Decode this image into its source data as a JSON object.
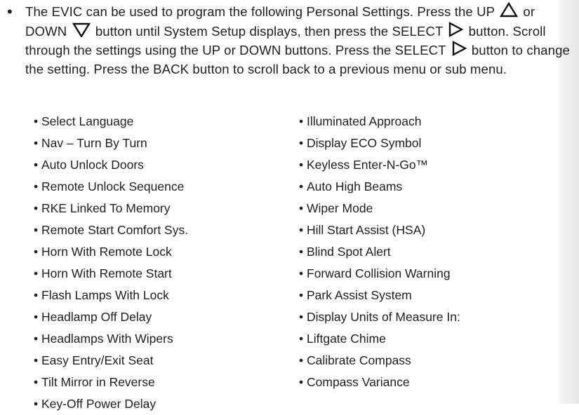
{
  "intro": {
    "bullet": "•",
    "seg1": "The EVIC can be used to program the following Personal Settings. Press the UP",
    "up_icon": "up-triangle-icon",
    "seg2": "or DOWN",
    "down_icon": "down-triangle-icon",
    "seg3": "button until System Setup displays, then press the SELECT",
    "select_icon": "right-triangle-icon",
    "seg4": "button. Scroll through the settings using the UP or DOWN buttons. Press the SELECT",
    "seg5": "button to change the setting. Press the BACK button to scroll back to a previous menu or sub menu."
  },
  "settings_left": [
    "Select Language",
    "Nav – Turn By Turn",
    "Auto Unlock Doors",
    "Remote Unlock Sequence",
    "RKE Linked To Memory",
    "Remote Start Comfort Sys.",
    "Horn With Remote Lock",
    "Horn With Remote Start",
    "Flash Lamps With Lock",
    "Headlamp Off Delay",
    "Headlamps With Wipers",
    "Easy Entry/Exit Seat",
    "Tilt Mirror in Reverse",
    "Key-Off Power Delay"
  ],
  "settings_right": [
    "Illuminated Approach",
    "Display ECO Symbol",
    "Keyless Enter-N-Go™",
    "Auto High Beams",
    "Wiper Mode",
    "Hill Start Assist (HSA)",
    "Blind Spot Alert",
    "Forward Collision Warning",
    "Park Assist System",
    "Display Units of Measure In:",
    "Liftgate Chime",
    "Calibrate Compass",
    "Compass Variance"
  ]
}
